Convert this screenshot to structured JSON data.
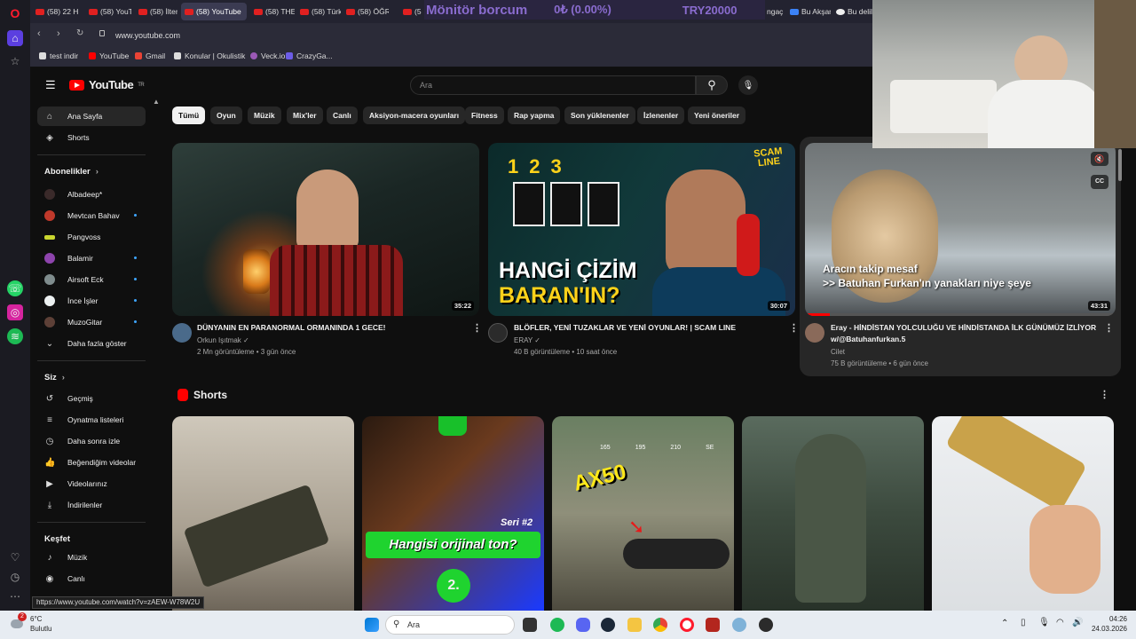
{
  "browser": {
    "tabs": [
      "(58) 22 H",
      "(58) YouT",
      "(58) İlter",
      "(58) YouTube",
      "(58) THE",
      "(58) Türk",
      "(58) ÖĞR",
      "(5"
    ],
    "tabs_right": [
      "ngaç",
      "Bu Akşan",
      "Bu delile"
    ],
    "url": "www.youtube.com",
    "bookmarks": [
      "test indir",
      "YouTube",
      "Gmail",
      "Konular | Okulistik",
      "Veck.io",
      "CrazyGa..."
    ],
    "status_url": "https://www.youtube.com/watch?v=zAEW-W78W2U"
  },
  "ticker": {
    "label": "Mönitör borcum",
    "value": "0₺ (0.00%)",
    "code": "TRY20000"
  },
  "youtube": {
    "logo": "YouTube",
    "logo_sup": "TR",
    "search_placeholder": "Ara",
    "sidebar": {
      "main": [
        {
          "icon": "home-icon",
          "label": "Ana Sayfa"
        },
        {
          "icon": "shorts-icon",
          "label": "Shorts"
        }
      ],
      "subs_heading": "Abonelikler",
      "subs": [
        {
          "label": "Albadeep*",
          "color": "#3a2a2a",
          "dot": false
        },
        {
          "label": "Mevtcan Bahav",
          "color": "#c0392b",
          "dot": true
        },
        {
          "label": "Pangvoss",
          "color": "#c9d62f",
          "dot": false
        },
        {
          "label": "Balamir",
          "color": "#8e44ad",
          "dot": true
        },
        {
          "label": "Airsoft Eck",
          "color": "#7f8c8d",
          "dot": true
        },
        {
          "label": "İnce İşler",
          "color": "#ecf0f1",
          "dot": true
        },
        {
          "label": "MuzoGitar",
          "color": "#5d4037",
          "dot": true
        }
      ],
      "show_more": "Daha fazla göster",
      "you_heading": "Siz",
      "you": [
        {
          "icon": "history-icon",
          "label": "Geçmiş"
        },
        {
          "icon": "playlist-icon",
          "label": "Oynatma listeleri"
        },
        {
          "icon": "watch-later-icon",
          "label": "Daha sonra izle"
        },
        {
          "icon": "like-icon",
          "label": "Beğendiğim videolar"
        },
        {
          "icon": "your-videos-icon",
          "label": "Videolarınız"
        },
        {
          "icon": "download-icon",
          "label": "İndirilenler"
        }
      ],
      "explore_heading": "Keşfet",
      "explore": [
        {
          "icon": "music-icon",
          "label": "Müzik"
        },
        {
          "icon": "live-icon",
          "label": "Canlı"
        }
      ]
    },
    "chips": [
      "Tümü",
      "Oyun",
      "Müzik",
      "Mix'ler",
      "Canlı",
      "Aksiyon-macera oyunları",
      "Fitness",
      "Rap yapma",
      "Son yüklenenler",
      "İzlenenler",
      "Yeni öneriler"
    ],
    "videos": [
      {
        "title": "DÜNYANIN EN PARANORMAL ORMANINDA 1 GECE!",
        "channel": "Orkun Işıtmak",
        "meta": "2 Mn görüntüleme • 3 gün önce",
        "duration": "35:22"
      },
      {
        "title": "BLÖFLER, YENİ TUZAKLAR VE YENİ OYUNLAR! | SCAM LINE",
        "channel": "ERAY",
        "meta": "40 B görüntüleme • 10 saat önce",
        "duration": "30:07",
        "thumb_text": "HANGİ ÇİZİM",
        "thumb_text2": "BARAN'IN?",
        "thumb_badge": "SCAM LINE",
        "thumb_nums": [
          "1",
          "2",
          "3"
        ]
      },
      {
        "title": "Eray - HİNDİSTAN YOLCULUĞU VE HİNDİSTANDA İLK GÜNÜMÜZ İZLİYOR w/@Batuhanfurkan.5",
        "channel": "Cilet",
        "meta": "75 B görüntüleme • 6 gün önce",
        "duration": "43:31",
        "caption1": "Aracın takip mesaf",
        "caption2": ">> Batuhan Furkan'ın yanakları niye şeye"
      }
    ],
    "shorts_heading": "Shorts",
    "shorts": [
      {
        "text": ""
      },
      {
        "text": "Hangisi orijinal ton?",
        "text2": "Seri #2",
        "text3": "2."
      },
      {
        "text": "AX50",
        "hud": [
          "165",
          "195",
          "210",
          "SE"
        ]
      },
      {
        "text": ""
      },
      {
        "text": ""
      }
    ]
  },
  "taskbar": {
    "weather_temp": "6°C",
    "weather_desc": "Bulutlu",
    "weather_badge": "2",
    "search": "Ara",
    "time": "04:26",
    "date": "24.03.2026"
  }
}
